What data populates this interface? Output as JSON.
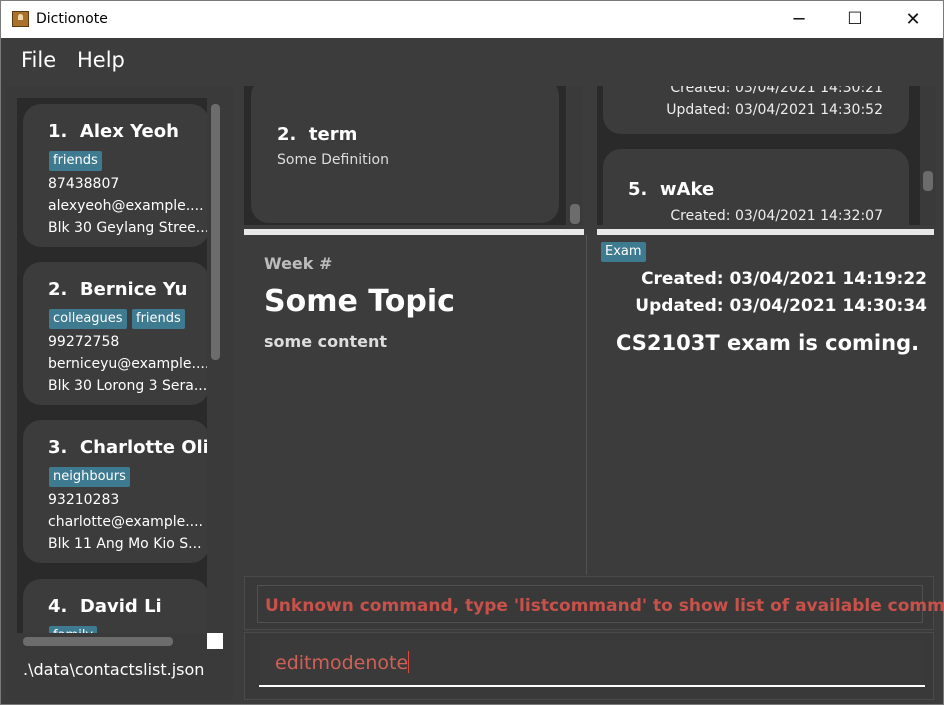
{
  "window": {
    "title": "Dictionote",
    "controls": {
      "minimize": "─",
      "maximize": "☐",
      "close": "✕"
    }
  },
  "menu": {
    "file": "File",
    "help": "Help"
  },
  "contacts": [
    {
      "index": "1.",
      "name": "Alex Yeoh",
      "tags": [
        "friends"
      ],
      "phone": "87438807",
      "email": "alexyeoh@example....",
      "address": "Blk 30 Geylang Stree..."
    },
    {
      "index": "2.",
      "name": "Bernice Yu",
      "tags": [
        "colleagues",
        "friends"
      ],
      "phone": "99272758",
      "email": "berniceyu@example....",
      "address": "Blk 30 Lorong 3 Sera..."
    },
    {
      "index": "3.",
      "name": "Charlotte Oli...",
      "tags": [
        "neighbours"
      ],
      "phone": "93210283",
      "email": "charlotte@example....",
      "address": "Blk 11 Ang Mo Kio S..."
    },
    {
      "index": "4.",
      "name": "David Li",
      "tags": [
        "family"
      ],
      "phone": "",
      "email": "",
      "address": ""
    }
  ],
  "contacts_file": ".\\data\\contactslist.json",
  "dictionary_list": {
    "items": [
      {
        "index": "2.",
        "term": "term",
        "definition": "Some Definition"
      }
    ]
  },
  "notes_list": {
    "items": [
      {
        "created": "Created: 03/04/2021 14:30:21",
        "updated": "Updated: 03/04/2021 14:30:52"
      },
      {
        "index": "5.",
        "title": "wAke",
        "created": "Created: 03/04/2021 14:32:07"
      }
    ]
  },
  "content_view": {
    "week": "Week #",
    "topic": "Some Topic",
    "content": "some content"
  },
  "note_view": {
    "tag": "Exam",
    "created": "Created: 03/04/2021 14:19:22",
    "updated": "Updated: 03/04/2021 14:30:34",
    "text": "CS2103T exam is coming."
  },
  "result_display": {
    "message": "Unknown command, type 'listcommand' to show list of available command"
  },
  "command_box": {
    "value": "editmodenote"
  },
  "colors": {
    "background": "#3c3c3c",
    "tag": "#3e7b91",
    "error": "#c8514a"
  }
}
